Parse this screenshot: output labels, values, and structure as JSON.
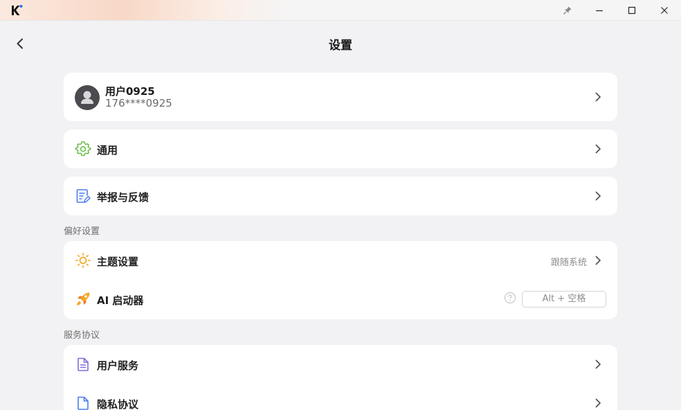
{
  "window": {
    "app_logo_icon": "k-logo-icon",
    "pin_icon": "pin-icon",
    "minimize_icon": "minimize-icon",
    "maximize_icon": "maximize-icon",
    "close_icon": "close-icon"
  },
  "header": {
    "back_icon": "chevron-left-icon",
    "title": "设置"
  },
  "account": {
    "name": "用户0925",
    "phone": "176****0925"
  },
  "general": {
    "label": "通用",
    "icon": "gear-icon",
    "icon_color": "#6cc04a"
  },
  "feedback": {
    "label": "举报与反馈",
    "icon": "document-edit-icon",
    "icon_color": "#4b7bec"
  },
  "preferences": {
    "section_label": "偏好设置",
    "theme": {
      "label": "主题设置",
      "value": "跟随系统",
      "icon": "sun-icon",
      "icon_color": "#f5a623"
    },
    "ai_launcher": {
      "label": "AI 启动器",
      "shortcut": "Alt + 空格",
      "icon": "rocket-icon",
      "icon_color": "#f5a623"
    }
  },
  "agreements": {
    "section_label": "服务协议",
    "user_service": {
      "label": "用户服务",
      "icon": "document-icon",
      "icon_color": "#7b6fd6"
    },
    "privacy": {
      "label": "隐私协议",
      "icon": "document-icon",
      "icon_color": "#4b7bec"
    }
  }
}
